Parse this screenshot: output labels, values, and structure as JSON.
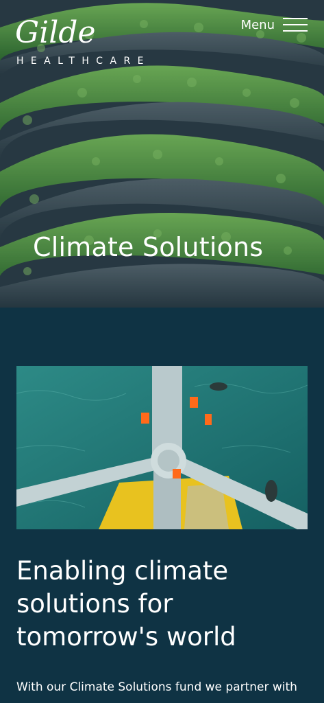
{
  "header": {
    "logo_script": "Gilde",
    "logo_subtitle": "HEALTHCARE",
    "menu_label": "Menu",
    "menu_icon": "hamburger-icon"
  },
  "hero": {
    "title": "Climate Solutions"
  },
  "main": {
    "heading": "Enabling climate solutions for tomorrow's world",
    "body": "With our Climate Solutions fund we partner with"
  },
  "colors": {
    "background": "#0f3344",
    "text": "#ffffff",
    "foliage": "#3f8a3a"
  }
}
